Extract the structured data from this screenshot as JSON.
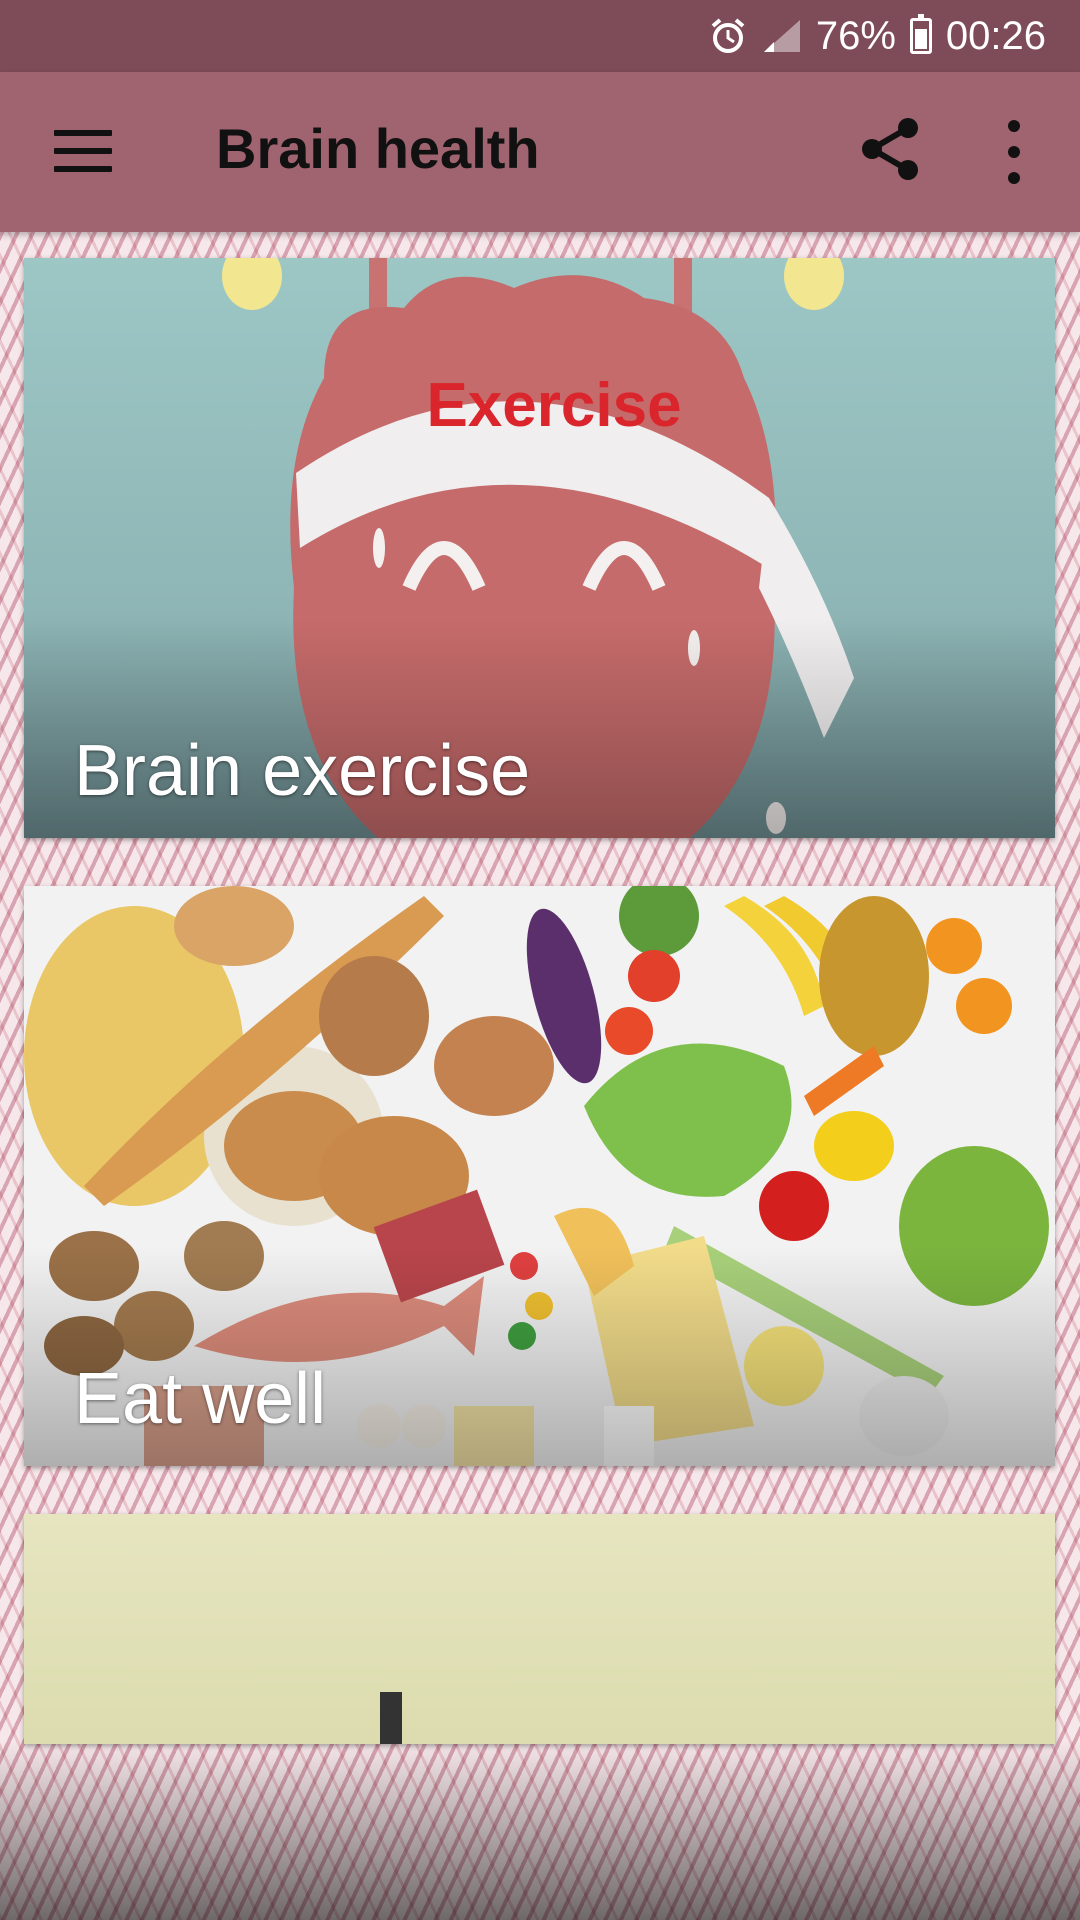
{
  "status_bar": {
    "battery_percent": "76%",
    "time": "00:26",
    "icons": [
      "alarm-icon",
      "signal-icon",
      "battery-icon"
    ]
  },
  "app_bar": {
    "title": "Brain health",
    "icons": [
      "menu-icon",
      "share-icon",
      "more-options-icon"
    ]
  },
  "cards": [
    {
      "label": "Brain exercise",
      "image_text": "Exercise"
    },
    {
      "label": "Eat well"
    },
    {
      "label": ""
    }
  ],
  "colors": {
    "status_bar": "#7e4b58",
    "app_bar": "#a06470",
    "exercise_red": "#d9252b"
  }
}
